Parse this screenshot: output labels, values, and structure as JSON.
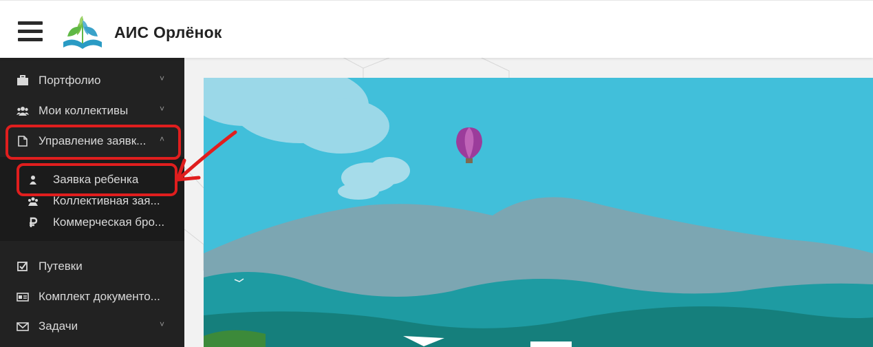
{
  "header": {
    "title": "АИС Орлёнок",
    "menu_icon": "hamburger-icon",
    "logo": "book-leaves-logo"
  },
  "sidebar": {
    "items": [
      {
        "label": "Портфолио",
        "icon": "briefcase-icon",
        "chevron": "˅"
      },
      {
        "label": "Мои коллективы",
        "icon": "users-icon",
        "chevron": "˅"
      },
      {
        "label": "Управление заявк...",
        "icon": "file-icon",
        "chevron": "˄"
      },
      {
        "label": "Путевки",
        "icon": "checkbox-icon"
      },
      {
        "label": "Комплект документо...",
        "icon": "id-card-icon"
      },
      {
        "label": "Задачи",
        "icon": "envelope-icon",
        "chevron": "˅"
      }
    ],
    "submenu": [
      {
        "label": "Заявка ребенка",
        "icon": "user-icon"
      },
      {
        "label": "Коллективная зая...",
        "icon": "group-icon"
      },
      {
        "label": "Коммерческая бро...",
        "icon": "ruble-icon"
      }
    ]
  },
  "colors": {
    "sidebar_bg": "#222222",
    "highlight": "#e01e1e",
    "sky": "#41bfda"
  }
}
